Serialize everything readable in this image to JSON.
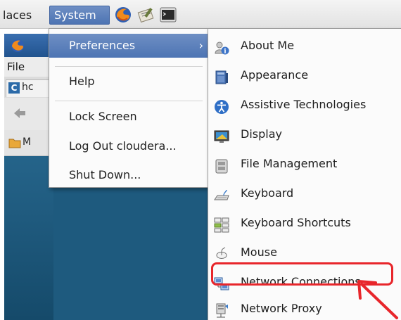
{
  "panel": {
    "places_label": "laces",
    "system_label": "System",
    "launchers": [
      "firefox-icon",
      "text-editor-icon",
      "terminal-icon"
    ]
  },
  "background_window": {
    "menu_file": "File",
    "tab_text": "hc",
    "tab_icon_letter": "C",
    "bookmark_text": "M"
  },
  "system_menu": {
    "items": [
      {
        "label": "Preferences",
        "highlighted": true,
        "has_submenu": true
      },
      {
        "label": "Help"
      },
      {
        "label": "Lock Screen"
      },
      {
        "label": "Log Out cloudera..."
      },
      {
        "label": "Shut Down..."
      }
    ],
    "submenu_arrow": "›"
  },
  "preferences_menu": {
    "items": [
      {
        "label": "About Me",
        "icon": "about-me-icon"
      },
      {
        "label": "Appearance",
        "icon": "appearance-icon"
      },
      {
        "label": "Assistive Technologies",
        "icon": "accessibility-icon"
      },
      {
        "label": "Display",
        "icon": "display-icon"
      },
      {
        "label": "File Management",
        "icon": "file-management-icon"
      },
      {
        "label": "Keyboard",
        "icon": "keyboard-icon"
      },
      {
        "label": "Keyboard Shortcuts",
        "icon": "keyboard-shortcuts-icon"
      },
      {
        "label": "Mouse",
        "icon": "mouse-icon"
      },
      {
        "label": "Network Connections",
        "icon": "network-connections-icon",
        "annotated": true
      },
      {
        "label": "Network Proxy",
        "icon": "network-proxy-icon"
      }
    ]
  },
  "colors": {
    "highlight": "#5a7fbb",
    "annotation": "#e8262b",
    "desktop": "#1e5a7e"
  }
}
